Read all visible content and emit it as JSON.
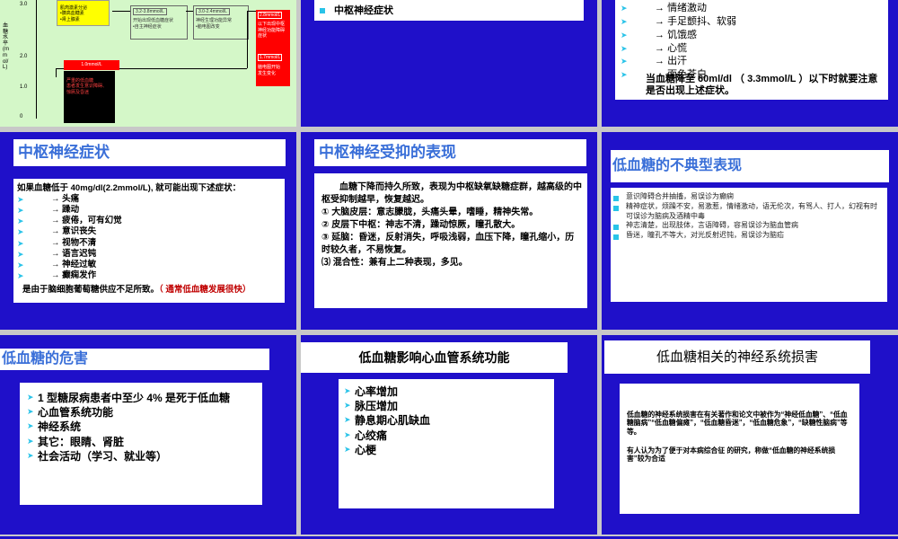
{
  "s1": {
    "ylabel": "血糖水平(mmol/L)",
    "yticks": [
      "2.0",
      "1.0",
      "0"
    ],
    "ytick_top": "3.0",
    "yellow_lines": [
      "肌肉激素分泌",
      "•胰高血糖素",
      "•肾上腺素"
    ],
    "box2": [
      "3.2-3.8mmol/L",
      "开始出现低血糖症状",
      "•自主神经症状"
    ],
    "box3": [
      "3.0-2.4mmol/L",
      "神经生理功能异常",
      "•脑电图改变"
    ],
    "red_upper": [
      "2.8mmol/L",
      "以下出现中枢",
      "神经功能障碍",
      "症状"
    ],
    "red_lower": [
      "1.7mmol/L",
      "脑电图开始",
      "发生变化"
    ],
    "black_title": "1.0mmol/L",
    "black_lines": [
      "严重的低血糖",
      "患者发生意识障碍、",
      "惊厥及昏迷"
    ]
  },
  "s2": {
    "item": "中枢神经症状"
  },
  "s3": {
    "items": [
      "情绪激动",
      "手足颤抖、软弱",
      "饥饿感",
      "心慌",
      "出汗",
      "面色苍白"
    ],
    "note": "当血糖降至 60ml/dl （ 3.3mmol/L ）以下时就要注意是否出现上述症状。"
  },
  "s4": {
    "title": "中枢神经症状",
    "intro": "如果血糖低于 40mg/dl(2.2mmol/L), 就可能出现下述症状：",
    "items": [
      "头痛",
      "躁动",
      "疲倦，可有幻觉",
      "意识丧失",
      "视物不清",
      "语言迟钝",
      "神经过敏",
      "癫痫发作"
    ],
    "footer": "是由于脑细胞葡萄糖供应不足所致。",
    "footer_red": "（ 通常低血糖发展很快）"
  },
  "s5": {
    "title": "中枢神经受抑的表现",
    "p1": "血糖下降而持久所致，表现为中枢缺氧缺糖症群，越高级的中枢受抑制越早，恢复越迟。",
    "p2": "① 大脑皮层：意志朦胧，头痛头晕，嗜睡，精神失常。",
    "p3": "② 皮层下中枢：神志不清，躁动惊厥，瞳孔散大。",
    "p4": "③ 延脑：昏迷，反射消失，呼吸浅弱，血压下降，瞳孔缩小，历时较久者，不易恢复。",
    "p5": "⑶ 混合性：兼有上二种表现，多见。"
  },
  "s6": {
    "title": "低血糖的不典型表现",
    "items": [
      "意识障碍合并抽搐，易误诊为癫痫",
      "精神症状，烦躁不安，易激惹，情绪激动，语无伦次，有骂人、打人，幻视有时可误诊为脑病及酒精中毒",
      "神志清楚，出现肢体，言语障碍，容易误诊为脑血管病",
      "昏迷，瞳孔不等大，对光反射迟钝，易误诊为脑疝"
    ]
  },
  "s7": {
    "title": "低血糖的危害",
    "items": [
      "1 型糖尿病患者中至少 4% 是死于低血糖",
      "心血管系统功能",
      "神经系统",
      "其它：眼睛、肾脏",
      "社会活动（学习、就业等）"
    ]
  },
  "s8": {
    "title": "低血糖影响心血管系统功能",
    "items": [
      "心率增加",
      "脉压增加",
      "静息期心肌缺血",
      "心绞痛",
      "心梗"
    ]
  },
  "s9": {
    "title": "低血糖相关的神经系统损害",
    "p1": "低血糖的神经系统损害在有关著作和论文中被作为“神经低血糖”、“低血糖脑病”“低血糖偏瘫”，“低血糖昏迷”，“低血糖危象”，“缺糖性脑病”等等。",
    "p2": "有人认为为了便于对本病综合征 的研究，称做“低血糖的神经系统损害”较为合适"
  },
  "colors": {
    "slide_bg": "#1f10c9",
    "bullet": "#29c3e8",
    "title_text": "#3a6fd8",
    "red": "#c00000"
  }
}
